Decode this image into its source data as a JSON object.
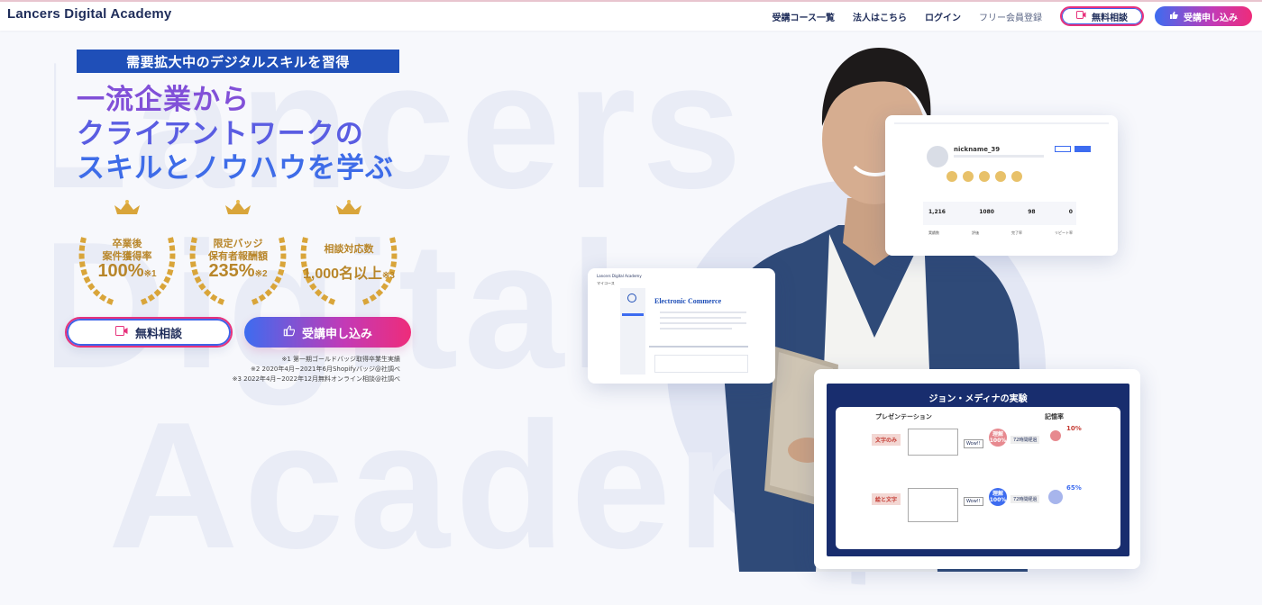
{
  "header": {
    "logo_lancers": "Lancers",
    "logo_rest": " Digital Academy",
    "nav": [
      "受講コース一覧",
      "法人はこちら",
      "ログイン",
      "フリー会員登録"
    ],
    "consult_label": "無料相談",
    "apply_label": "受講申し込み"
  },
  "hero": {
    "tagline": "需要拡大中のデジタルスキルを習得",
    "headline": [
      "一流企業から",
      "クライアントワークの",
      "スキルとノウハウを学ぶ"
    ],
    "badges": [
      {
        "label_1": "卒業後",
        "label_2": "案件獲得率",
        "value": "100%",
        "note": "※1"
      },
      {
        "label_1": "限定バッジ",
        "label_2": "保有者報酬額",
        "value": "235%",
        "note": "※2"
      },
      {
        "label_1": "相談対応数",
        "label_2": "",
        "value": "1,000名以上",
        "note": "※3"
      }
    ],
    "cta_consult": "無料相談",
    "cta_apply": "受講申し込み",
    "notes": [
      "※1 第一期ゴールドバッジ取得卒業生実績",
      "※2 2020年4月~2021年6月Shopifyバッジ@社調べ",
      "※3 2022年4月~2022年12月無料オンライン相談@社調べ"
    ]
  },
  "watermark": [
    "Lancers",
    "Digital",
    "Academy"
  ],
  "profile_card": {
    "nickname": "nickname_39",
    "stats": [
      "1,216",
      "1080",
      "98",
      "0"
    ],
    "cols": [
      "実績数",
      "評価",
      "完了率",
      "リピート率"
    ]
  },
  "ec_card": {
    "app_title": "Lancers Digital Academy",
    "section": "マイコース",
    "course_title": "Electronic Commerce"
  },
  "slide_card": {
    "title": "ジョン・メディナの実験",
    "presentation": "プレゼンテーション",
    "memory": "記憶率",
    "text_only": "文字のみ",
    "pic_text": "絵と文字",
    "bubble1": "理解100%",
    "bubble2": "理解100%",
    "pct1": "10%",
    "pct2": "65%",
    "wow": "Wow!!",
    "delay": "72時間経過"
  },
  "colors": {
    "navy": "#1f2d5a",
    "tag_blue": "#1f4fb8",
    "gold": "#b8862a",
    "gradient_start": "#3d6cf0",
    "gradient_end": "#ee2c7a"
  }
}
